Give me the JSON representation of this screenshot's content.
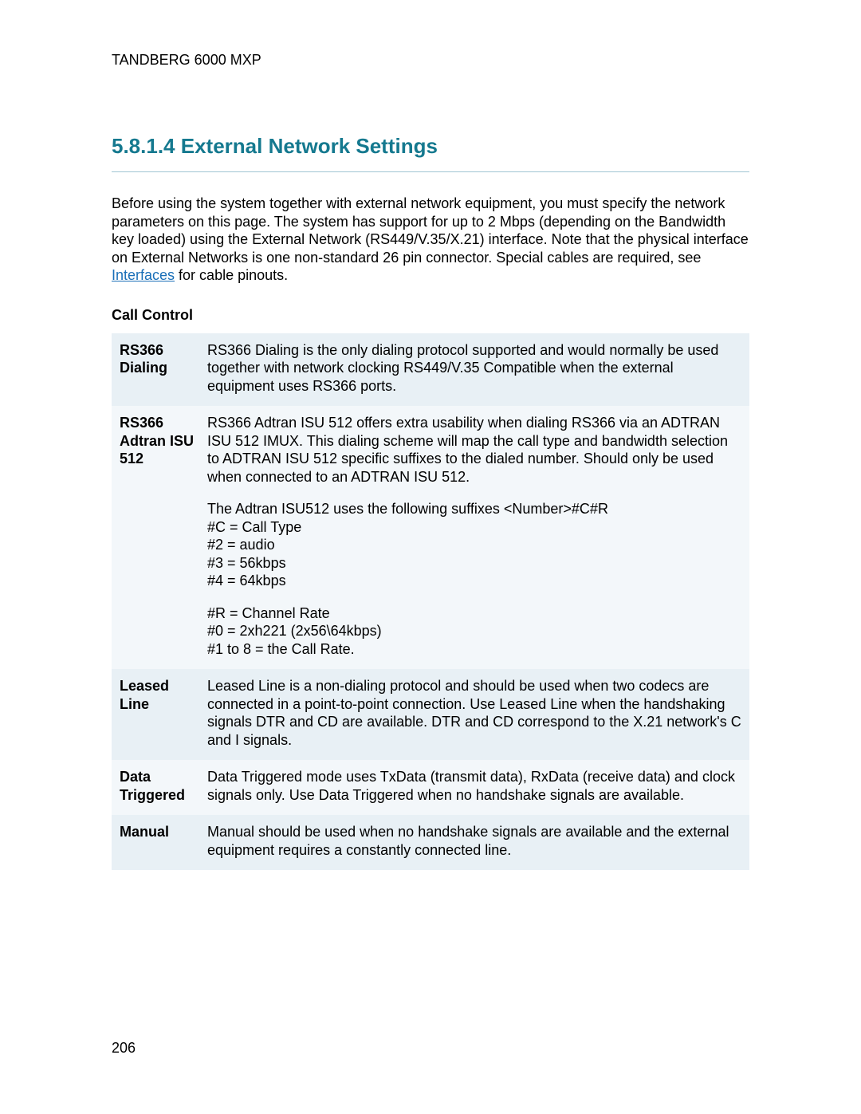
{
  "header": "TANDBERG 6000 MXP",
  "section_number": "5.8.1.4",
  "section_title": "External Network Settings",
  "intro": {
    "before_link": "Before using the system together with external network equipment, you must specify the network parameters on this page. The system has support for up to 2 Mbps (depending on the Bandwidth key loaded) using the External Network (RS449/V.35/X.21) interface. Note that the physical interface on External Networks is one non-standard 26 pin connector. Special cables are required, see ",
    "link_text": "Interfaces",
    "after_link": " for cable pinouts."
  },
  "subsection_title": "Call Control",
  "rows": [
    {
      "stripe": "a",
      "term": "RS366 Dialing",
      "paragraphs": [
        "RS366 Dialing is the only dialing protocol supported and would normally be used together with network clocking RS449/V.35 Compatible when the external equipment uses RS366 ports."
      ]
    },
    {
      "stripe": "b",
      "term": "RS366 Adtran ISU 512",
      "paragraphs": [
        "RS366 Adtran ISU 512 offers extra usability when dialing RS366 via an ADTRAN ISU 512 IMUX. This dialing scheme will map the call type and bandwidth selection to ADTRAN ISU 512 specific suffixes to the dialed number. Should only be used when connected to an ADTRAN ISU 512.",
        "The Adtran ISU512 uses the following suffixes <Number>#C#R\n#C = Call Type\n#2 = audio\n#3 = 56kbps\n#4 = 64kbps",
        "#R = Channel Rate\n#0 = 2xh221 (2x56\\64kbps)\n#1 to 8 = the Call Rate."
      ]
    },
    {
      "stripe": "a",
      "term": "Leased Line",
      "paragraphs": [
        "Leased Line is a non-dialing protocol and should be used when two codecs are connected in a point-to-point connection. Use Leased Line when the handshaking signals DTR and CD are available. DTR and CD correspond to the X.21 network's C and I signals."
      ]
    },
    {
      "stripe": "b",
      "term": "Data Triggered",
      "paragraphs": [
        "Data Triggered mode uses TxData (transmit data), RxData (receive data) and clock signals only. Use Data Triggered when no handshake signals are available."
      ]
    },
    {
      "stripe": "a",
      "term": "Manual",
      "paragraphs": [
        "Manual should be used when no handshake signals are available and the external equipment requires a constantly connected line."
      ]
    }
  ],
  "page_number": "206"
}
